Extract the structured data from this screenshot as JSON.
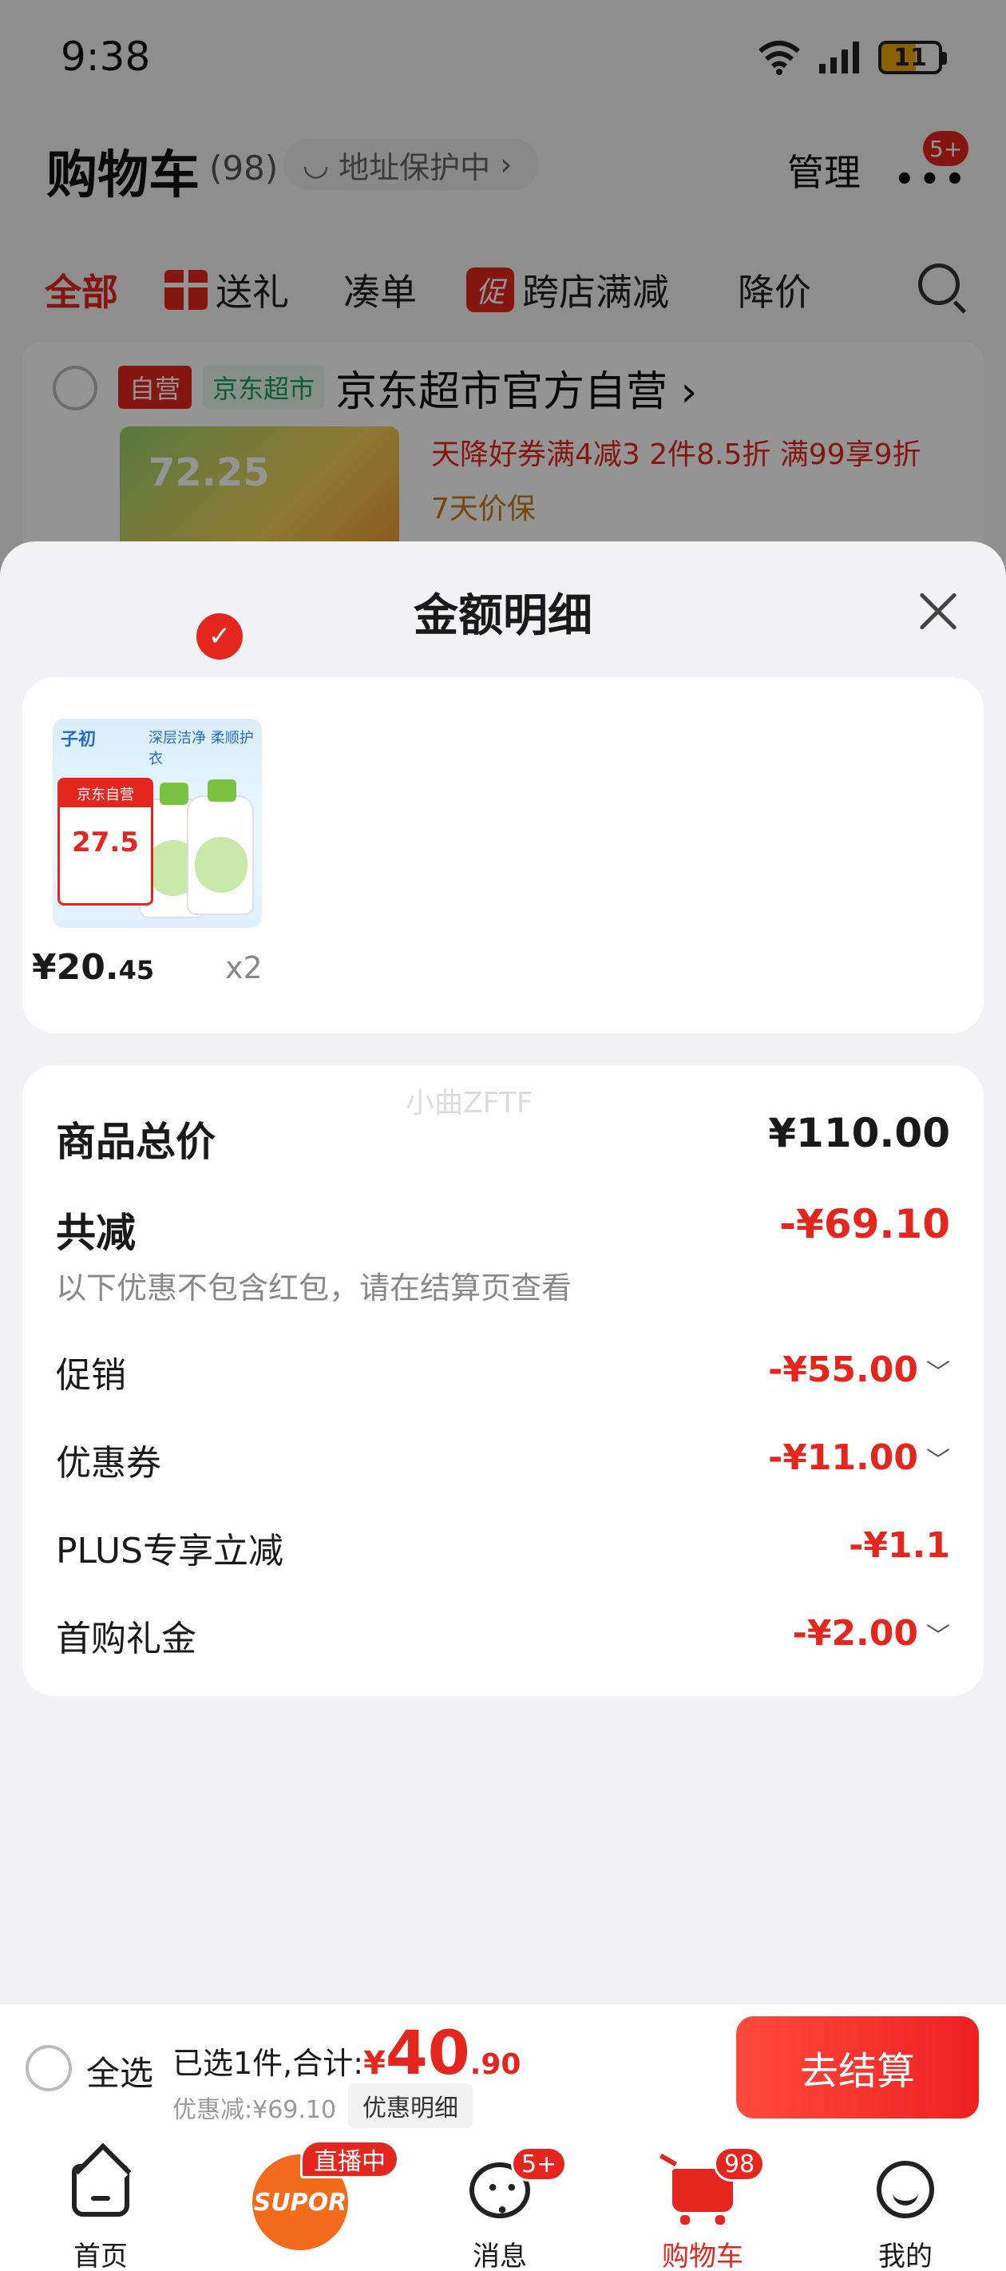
{
  "status_bar": {
    "time": "9:38",
    "battery": "11"
  },
  "header": {
    "title": "购物车",
    "count": "(98)",
    "address_pill": "地址保护中",
    "manage": "管理",
    "more_badge": "5+"
  },
  "tabs": [
    {
      "label": "全部",
      "active": true
    },
    {
      "label": "送礼"
    },
    {
      "label": "凑单"
    },
    {
      "label": "跨店满减",
      "tag": "促"
    },
    {
      "label": "降价"
    }
  ],
  "store": {
    "tag_self": "自营",
    "tag_market": "京东超市",
    "name": "京东超市官方自营",
    "thumb_price": "72.25",
    "promo": "天降好券满4减3  2件8.5折  满99享9折",
    "protect": "7天价保"
  },
  "sheet": {
    "title": "金额明细",
    "product": {
      "image_brand": "子初",
      "image_slogan": "深层洁净 柔顺护衣",
      "image_badge_top": "京东自营",
      "image_badge_price": "27.5",
      "price_main": "¥20.",
      "price_decimal": "45",
      "qty": "x2"
    },
    "watermark": "小曲ZFTF",
    "total_label": "商品总价",
    "total_value": "¥110.00",
    "reduce_label": "共减",
    "reduce_value": "-¥69.10",
    "note": "以下优惠不包含红包，请在结算页查看",
    "rows": [
      {
        "label": "促销",
        "value": "-¥55.00",
        "expandable": true
      },
      {
        "label": "优惠券",
        "value": "-¥11.00",
        "expandable": true
      },
      {
        "label": "PLUS专享立减",
        "value": "-¥1.1",
        "expandable": false
      },
      {
        "label": "首购礼金",
        "value": "-¥2.00",
        "expandable": true
      }
    ]
  },
  "checkout": {
    "select_all": "全选",
    "selected_text": "已选1件,合计:",
    "yen": "¥",
    "total_int": "40",
    "total_dec": ".90",
    "discount_text": "优惠减:¥69.10",
    "discount_detail": "优惠明细",
    "button": "去结算"
  },
  "nav": {
    "home": "首页",
    "live_brand": "SUPOR",
    "live_badge": "直播中",
    "messages": "消息",
    "messages_badge": "5+",
    "cart": "购物车",
    "cart_badge": "98",
    "me": "我的"
  },
  "colors": {
    "accent": "#e4261e",
    "overlay": "rgba(0,0,0,0.42)"
  }
}
